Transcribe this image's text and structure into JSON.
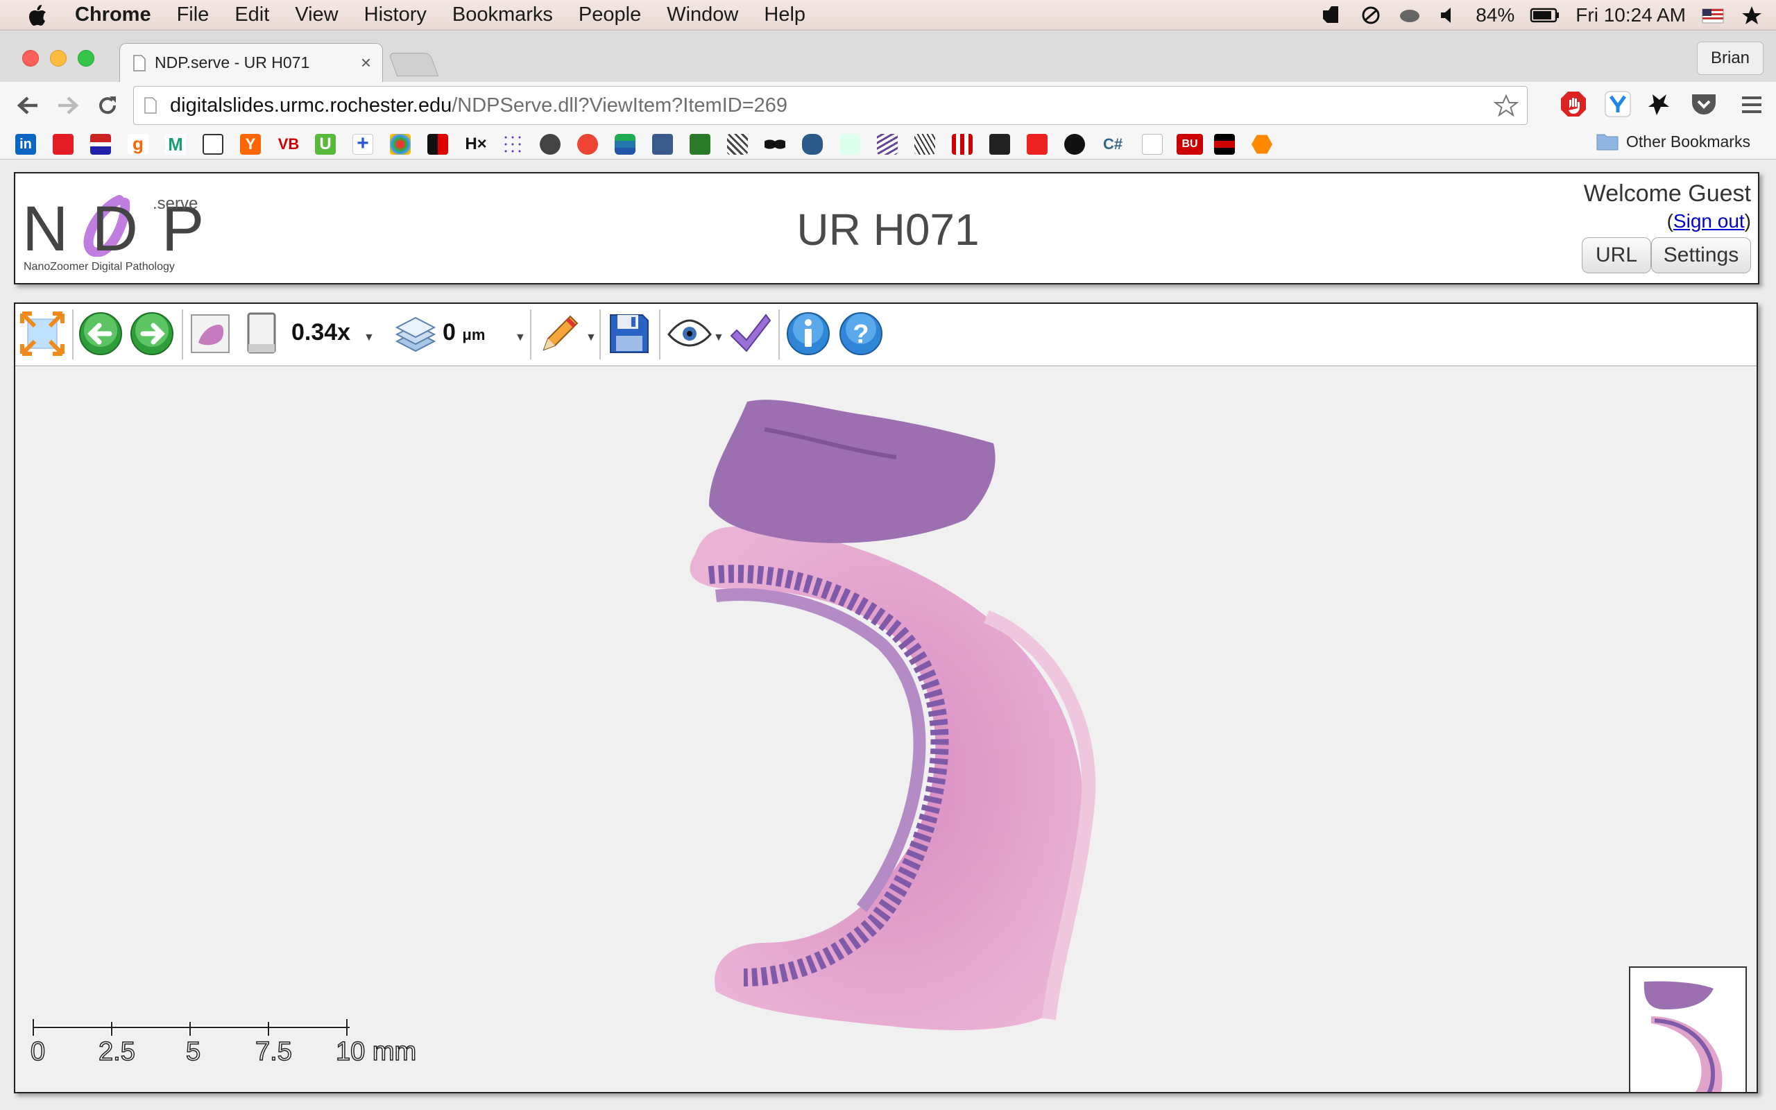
{
  "menubar": {
    "app": "Chrome",
    "items": [
      "File",
      "Edit",
      "View",
      "History",
      "Bookmarks",
      "People",
      "Window",
      "Help"
    ],
    "battery": "84%",
    "clock": "Fri 10:24 AM"
  },
  "browser": {
    "tab_title": "NDP.serve - UR H071",
    "profile": "Brian",
    "url_host": "digitalslides.urmc.rochester.edu",
    "url_path": "/NDPServe.dll?ViewItem?ItemID=269",
    "other_bookmarks": "Other Bookmarks",
    "bookmark_text": {
      "vb": "VB",
      "h": "H×",
      "cs": "C#",
      "bu": "BU"
    }
  },
  "ndp": {
    "logo_main": "NDP",
    "logo_serve": ".serve",
    "logo_tagline": "NanoZoomer Digital Pathology",
    "title": "UR H071",
    "welcome": "Welcome Guest",
    "sign_out": "Sign out",
    "url_button": "URL",
    "settings_button": "Settings"
  },
  "viewer": {
    "zoom": "0.34x",
    "focus_value": "0",
    "focus_unit": "μm",
    "scale_labels": [
      "0",
      "2.5",
      "5",
      "7.5",
      "10 mm"
    ]
  },
  "colors": {
    "tissue_purple": "#9b6fb0",
    "tissue_pink": "#e6a6cf",
    "logo_purple": "#c07ee0",
    "link_blue": "#0000cc"
  }
}
